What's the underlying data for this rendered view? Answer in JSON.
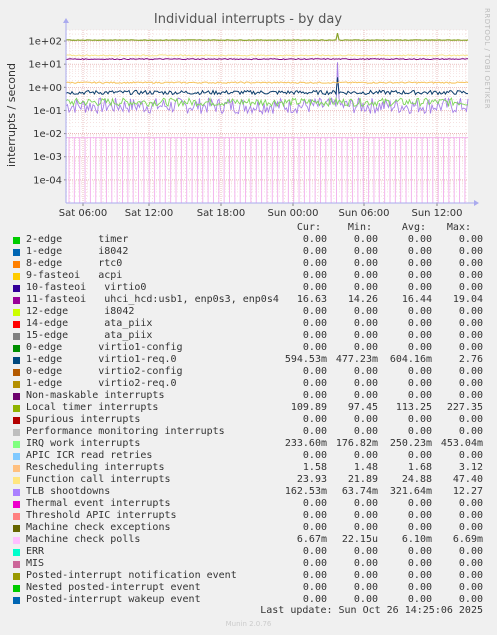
{
  "chart_data": {
    "type": "line",
    "title": "Individual interrupts - by day",
    "ylabel": "interrupts / second",
    "yscale": "log",
    "ylim": [
      1e-05,
      300
    ],
    "y_ticks": [
      "1e+02",
      "1e+01",
      "1e+00",
      "1e-01",
      "1e-02",
      "1e-03",
      "1e-04"
    ],
    "x_ticks": [
      "Sat 06:00",
      "Sat 12:00",
      "Sat 18:00",
      "Sun 00:00",
      "Sun 06:00",
      "Sun 12:00"
    ],
    "grid": true,
    "series_summary": [
      {
        "name": "Local timer interrupts",
        "level": 110,
        "color": "#8aa32a"
      },
      {
        "name": "11-fasteoi uhci_hcd:usb1, enp0s3, enp0s4",
        "level": 16.6,
        "color": "#800080"
      },
      {
        "name": "Function call interrupts",
        "level": 24,
        "color": "#f6e38a"
      },
      {
        "name": "Rescheduling interrupts",
        "level": 1.6,
        "color": "#f6c15a"
      },
      {
        "name": "1-edge virtio1-req.0",
        "level": 0.6,
        "color": "#0b3d6b"
      },
      {
        "name": "IRQ work interrupts",
        "level": 0.23,
        "color": "#7cd65a"
      },
      {
        "name": "TLB shootdowns",
        "level": 0.16,
        "color": "#a680e8"
      },
      {
        "name": "Machine check polls",
        "level": 0.0067,
        "color": "#f6b0f0"
      }
    ]
  },
  "side_label": "RRDTOOL / TOBI OETIKER",
  "legend": {
    "headers": {
      "cur": "Cur:",
      "min": "Min:",
      "avg": "Avg:",
      "max": "Max:"
    },
    "rows": [
      {
        "label": "2-edge      timer",
        "color": "#00cc00",
        "cur": "0.00",
        "min": "0.00",
        "avg": "0.00",
        "max": "0.00"
      },
      {
        "label": "1-edge      i8042",
        "color": "#0066b3",
        "cur": "0.00",
        "min": "0.00",
        "avg": "0.00",
        "max": "0.00"
      },
      {
        "label": "8-edge      rtc0",
        "color": "#ff8000",
        "cur": "0.00",
        "min": "0.00",
        "avg": "0.00",
        "max": "0.00"
      },
      {
        "label": "9-fasteoi   acpi",
        "color": "#ffcc00",
        "cur": "0.00",
        "min": "0.00",
        "avg": "0.00",
        "max": "0.00"
      },
      {
        "label": "10-fasteoi   virtio0",
        "color": "#330099",
        "cur": "0.00",
        "min": "0.00",
        "avg": "0.00",
        "max": "0.00"
      },
      {
        "label": "11-fasteoi   uhci_hcd:usb1, enp0s3, enp0s4",
        "color": "#990099",
        "cur": "16.63",
        "min": "14.26",
        "avg": "16.44",
        "max": "19.04"
      },
      {
        "label": "12-edge      i8042",
        "color": "#ccff00",
        "cur": "0.00",
        "min": "0.00",
        "avg": "0.00",
        "max": "0.00"
      },
      {
        "label": "14-edge      ata_piix",
        "color": "#ff0000",
        "cur": "0.00",
        "min": "0.00",
        "avg": "0.00",
        "max": "0.00"
      },
      {
        "label": "15-edge      ata_piix",
        "color": "#808080",
        "cur": "0.00",
        "min": "0.00",
        "avg": "0.00",
        "max": "0.00"
      },
      {
        "label": "0-edge      virtio1-config",
        "color": "#008f00",
        "cur": "0.00",
        "min": "0.00",
        "avg": "0.00",
        "max": "0.00"
      },
      {
        "label": "1-edge      virtio1-req.0",
        "color": "#00487d",
        "cur": "594.53m",
        "min": "477.23m",
        "avg": "604.16m",
        "max": "2.76"
      },
      {
        "label": "0-edge      virtio2-config",
        "color": "#b35a00",
        "cur": "0.00",
        "min": "0.00",
        "avg": "0.00",
        "max": "0.00"
      },
      {
        "label": "1-edge      virtio2-req.0",
        "color": "#b38f00",
        "cur": "0.00",
        "min": "0.00",
        "avg": "0.00",
        "max": "0.00"
      },
      {
        "label": "Non-maskable interrupts",
        "color": "#6b006b",
        "cur": "0.00",
        "min": "0.00",
        "avg": "0.00",
        "max": "0.00"
      },
      {
        "label": "Local timer interrupts",
        "color": "#8fb300",
        "cur": "109.89",
        "min": "97.45",
        "avg": "113.25",
        "max": "227.35"
      },
      {
        "label": "Spurious interrupts",
        "color": "#b30000",
        "cur": "0.00",
        "min": "0.00",
        "avg": "0.00",
        "max": "0.00"
      },
      {
        "label": "Performance monitoring interrupts",
        "color": "#bebebe",
        "cur": "0.00",
        "min": "0.00",
        "avg": "0.00",
        "max": "0.00"
      },
      {
        "label": "IRQ work interrupts",
        "color": "#80ff80",
        "cur": "233.60m",
        "min": "176.82m",
        "avg": "250.23m",
        "max": "453.04m"
      },
      {
        "label": "APIC ICR read retries",
        "color": "#80c9ff",
        "cur": "0.00",
        "min": "0.00",
        "avg": "0.00",
        "max": "0.00"
      },
      {
        "label": "Rescheduling interrupts",
        "color": "#ffc080",
        "cur": "1.58",
        "min": "1.48",
        "avg": "1.68",
        "max": "3.12"
      },
      {
        "label": "Function call interrupts",
        "color": "#ffe680",
        "cur": "23.93",
        "min": "21.89",
        "avg": "24.88",
        "max": "47.40"
      },
      {
        "label": "TLB shootdowns",
        "color": "#aa80ff",
        "cur": "162.53m",
        "min": "63.74m",
        "avg": "321.64m",
        "max": "12.27"
      },
      {
        "label": "Thermal event interrupts",
        "color": "#ee00cc",
        "cur": "0.00",
        "min": "0.00",
        "avg": "0.00",
        "max": "0.00"
      },
      {
        "label": "Threshold APIC interrupts",
        "color": "#ff8080",
        "cur": "0.00",
        "min": "0.00",
        "avg": "0.00",
        "max": "0.00"
      },
      {
        "label": "Machine check exceptions",
        "color": "#666600",
        "cur": "0.00",
        "min": "0.00",
        "avg": "0.00",
        "max": "0.00"
      },
      {
        "label": "Machine check polls",
        "color": "#ffbfff",
        "cur": "6.67m",
        "min": "22.15u",
        "avg": "6.10m",
        "max": "6.69m"
      },
      {
        "label": "ERR",
        "color": "#00ffcc",
        "cur": "0.00",
        "min": "0.00",
        "avg": "0.00",
        "max": "0.00"
      },
      {
        "label": "MIS",
        "color": "#cc6699",
        "cur": "0.00",
        "min": "0.00",
        "avg": "0.00",
        "max": "0.00"
      },
      {
        "label": "Posted-interrupt notification event",
        "color": "#999900",
        "cur": "0.00",
        "min": "0.00",
        "avg": "0.00",
        "max": "0.00"
      },
      {
        "label": "Nested posted-interrupt event",
        "color": "#00cc00",
        "cur": "0.00",
        "min": "0.00",
        "avg": "0.00",
        "max": "0.00"
      },
      {
        "label": "Posted-interrupt wakeup event",
        "color": "#0066b3",
        "cur": "0.00",
        "min": "0.00",
        "avg": "0.00",
        "max": "0.00"
      }
    ]
  },
  "footer": "Last update: Sun Oct 26 14:25:06 2025",
  "munin_version": "Munin 2.0.76"
}
